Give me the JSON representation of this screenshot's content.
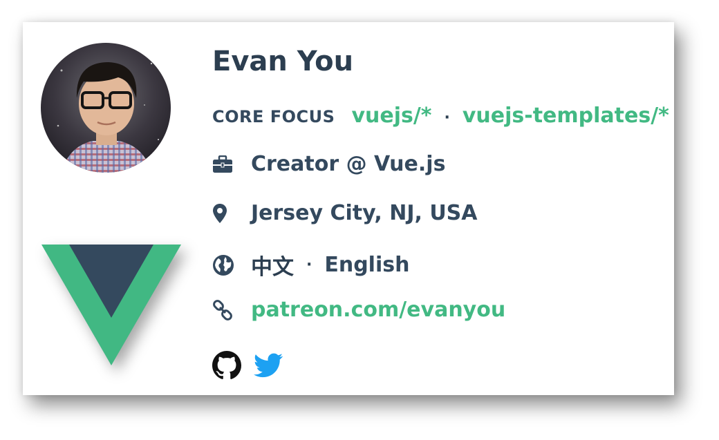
{
  "profile": {
    "name": "Evan You",
    "core_focus_label": "CORE FOCUS",
    "core_focus": [
      "vuejs/*",
      "vuejs-templates/*"
    ],
    "separator": "·",
    "role": "Creator @ Vue.js",
    "location": "Jersey City, NJ, USA",
    "languages": [
      "中文",
      "English"
    ],
    "website": "patreon.com/evanyou"
  },
  "icons": {
    "role": "briefcase-icon",
    "location": "map-marker-icon",
    "languages": "globe-icon",
    "website": "link-icon",
    "social": [
      "github-icon",
      "twitter-icon"
    ]
  },
  "colors": {
    "accent": "#42b983",
    "text_dark": "#2c3e50",
    "twitter": "#1da1f2",
    "vue_green": "#41b883",
    "vue_navy": "#34495e"
  }
}
